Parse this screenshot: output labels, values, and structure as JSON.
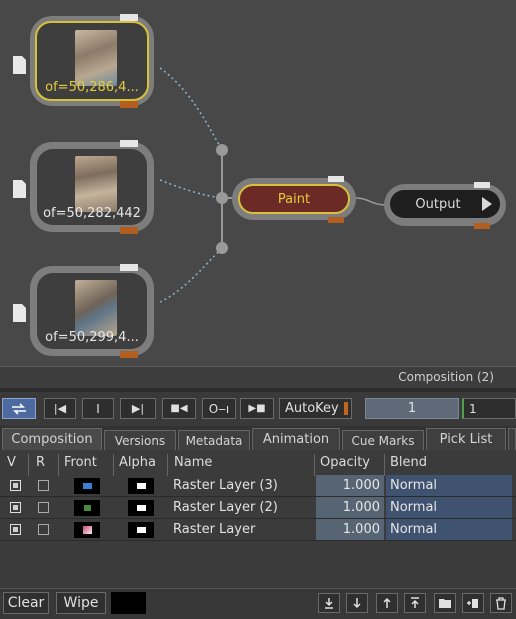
{
  "graph": {
    "sources": [
      {
        "label": "of=50,286,4...",
        "selected": true
      },
      {
        "label": "of=50,282,442",
        "selected": false
      },
      {
        "label": "of=50,299,4...",
        "selected": false
      }
    ],
    "paint_label": "Paint",
    "output_label": "Output",
    "composition_title": "Composition (2)"
  },
  "toolbar": {
    "autokey_label": "AutoKey",
    "frame_value": "1",
    "frame_value_2": "1",
    "i_label": "I"
  },
  "tabs": [
    "Composition",
    "Versions",
    "Metadata",
    "Animation",
    "Cue Marks",
    "Pick List"
  ],
  "table": {
    "headers": [
      "V",
      "R",
      "Front",
      "Alpha",
      "Name",
      "Opacity",
      "Blend"
    ],
    "rows": [
      {
        "name": "Raster Layer (3)",
        "opacity": "1.000",
        "blend": "Normal",
        "v": true,
        "r": false
      },
      {
        "name": "Raster Layer (2)",
        "opacity": "1.000",
        "blend": "Normal",
        "v": true,
        "r": false
      },
      {
        "name": "Raster Layer",
        "opacity": "1.000",
        "blend": "Normal",
        "v": true,
        "r": false
      }
    ]
  },
  "bottom": {
    "clear_label": "Clear",
    "wipe_label": "Wipe"
  },
  "colors": {
    "selected_outline": "#d8c13a",
    "paint_fill": "#6b2a26",
    "field_blue": "#576474",
    "blend_blue": "#3f5270"
  }
}
